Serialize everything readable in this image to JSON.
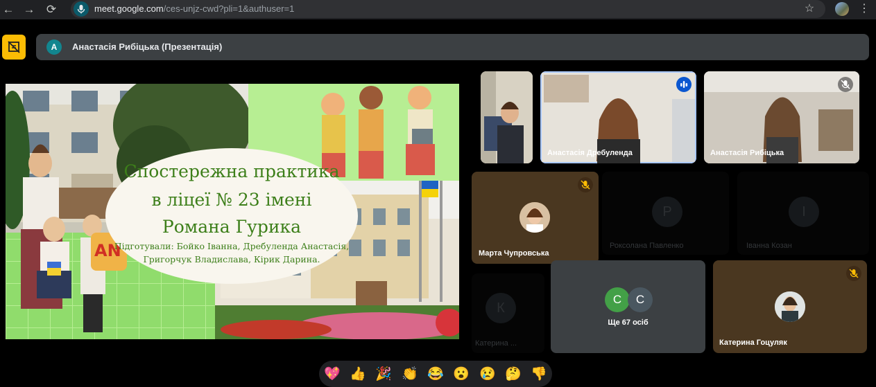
{
  "browser": {
    "url_domain": "meet.google.com",
    "url_path": "/ces-unjz-cwd?pli=1&authuser=1",
    "icons": [
      "back-arrow-icon",
      "forward-arrow-icon",
      "reload-icon",
      "mic-icon",
      "star-icon",
      "profile-icon",
      "menu-dots-icon"
    ]
  },
  "meeting": {
    "presenter_initial": "A",
    "presenter_title": "Анастасія Рибіцька (Презентація)"
  },
  "slide": {
    "title_lines": [
      "Спостережна практика",
      "в ліцеї № 23 імені",
      "Романа Гурика"
    ],
    "subtitle_lines": [
      "Підготували: Бойко Іванна, Дребуленда Анастасія,",
      "Григорчук Владислава, Кірик Дарина."
    ],
    "badge_text": "AN"
  },
  "participants": {
    "tile_drebulenda": "Анастасія Дребуленда",
    "tile_rybitska": "Анастасія Рибіцька",
    "tile_chuprovska": "Марта Чупровська",
    "tile_pavlenko": "Роксолана Павленко",
    "tile_pavlenko_initial": "Р",
    "tile_kozan": "Іванна Козан",
    "tile_kozan_initial": "І",
    "tile_kateryna": "Катерина ...",
    "tile_kateryna_initial": "К",
    "tile_hotsuliak": "Катерина Гоцуляк",
    "more_initials": [
      "C",
      "C"
    ],
    "more_label": "Ще 67 осіб"
  },
  "reactions": [
    "💖",
    "👍",
    "🎉",
    "👏",
    "😂",
    "😮",
    "😢",
    "🤔",
    "👎"
  ],
  "colors": {
    "accent_yellow": "#fbbc04",
    "avatar_teal": "#12868f",
    "speaking_border": "#a8c7fa"
  }
}
